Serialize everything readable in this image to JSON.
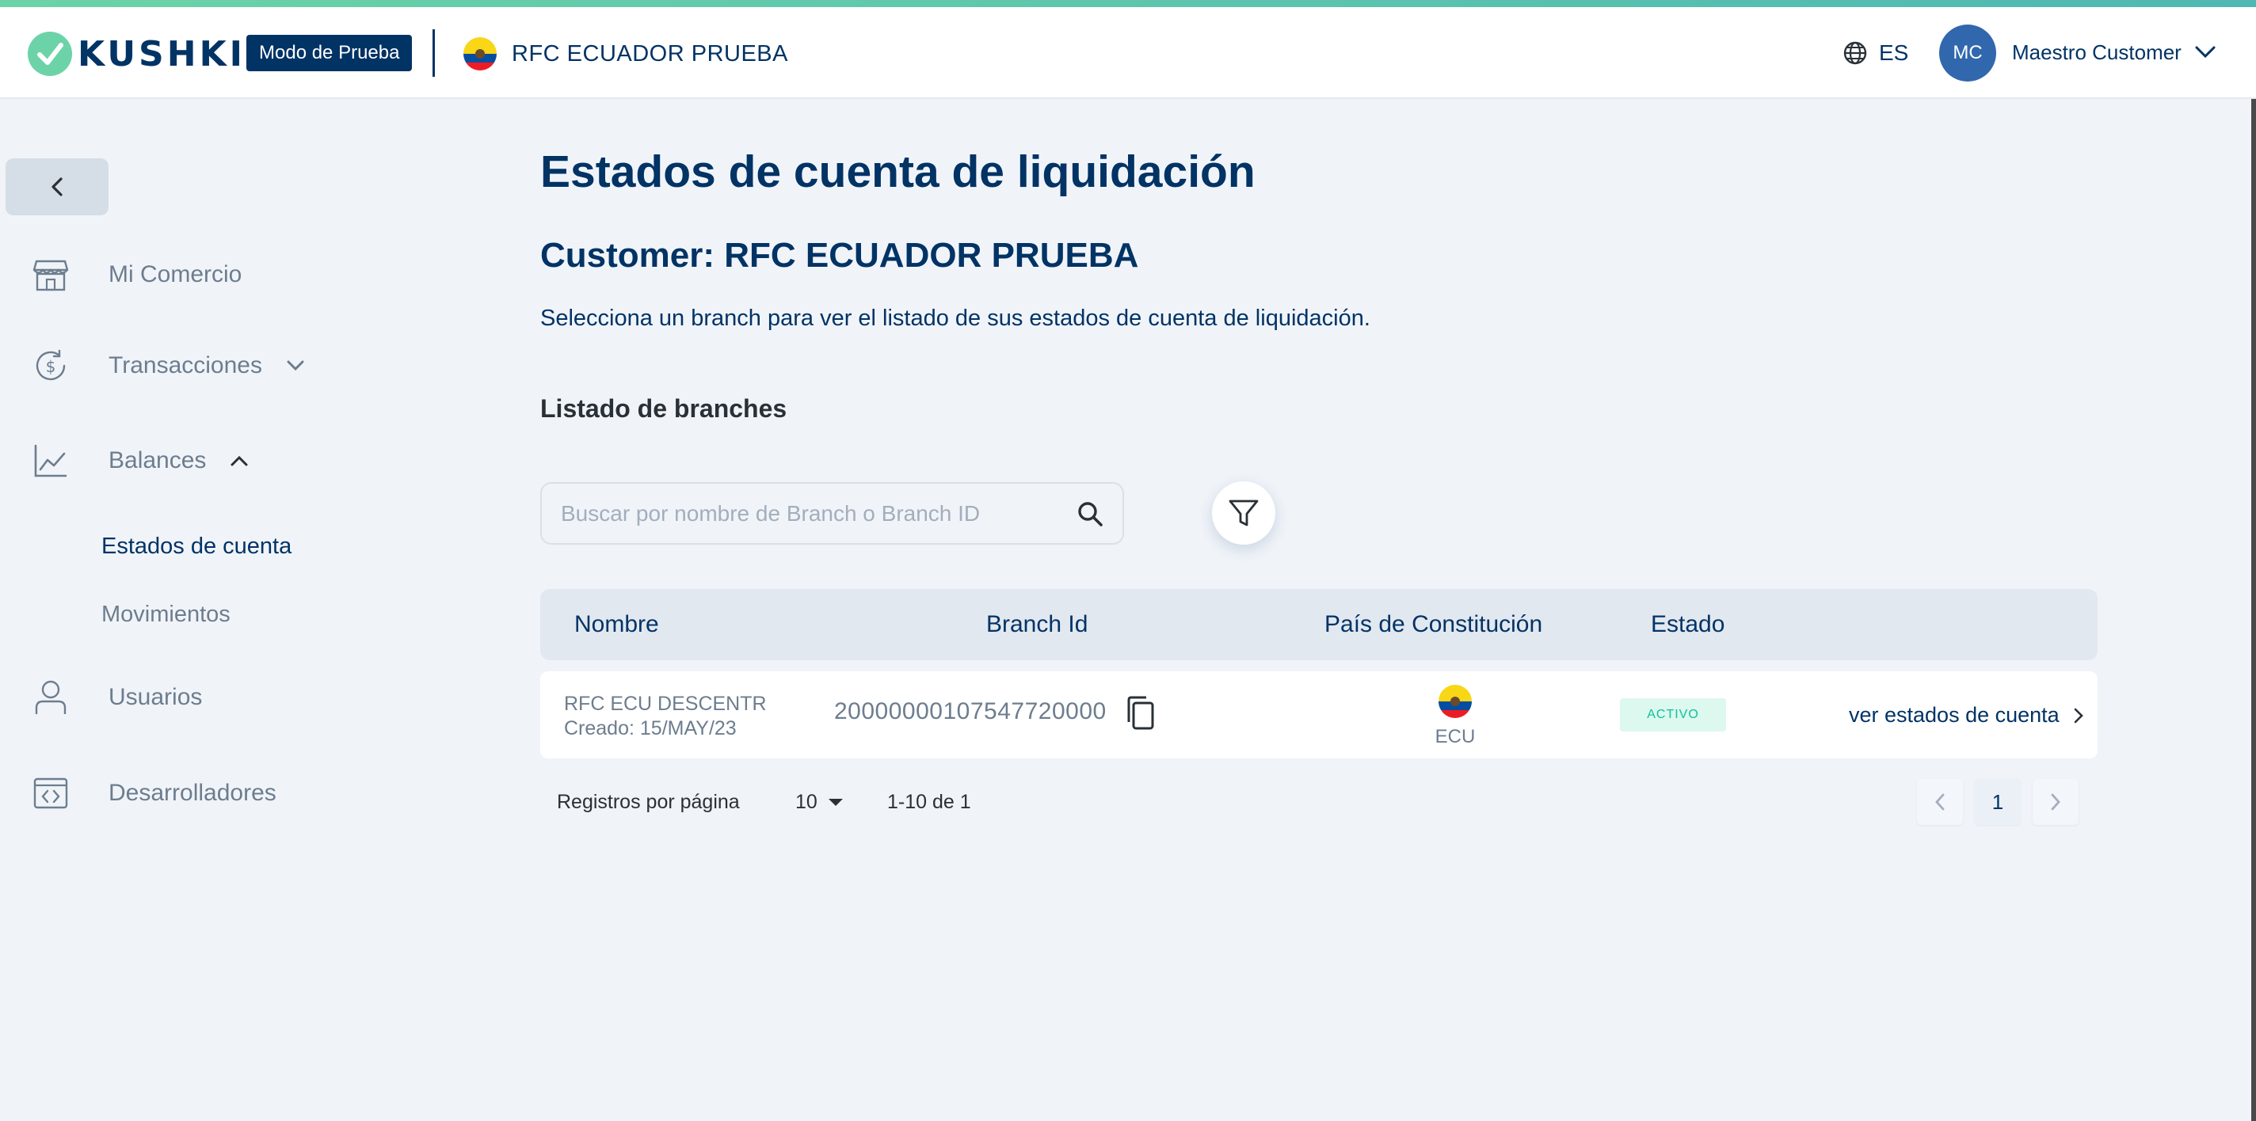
{
  "header": {
    "logo_text": "KUSHKI",
    "mode_badge": "Modo de Prueba",
    "merchant_name": "RFC ECUADOR PRUEBA",
    "language": "ES",
    "user_initials": "MC",
    "user_name": "Maestro Customer"
  },
  "sidebar": {
    "items": [
      {
        "label": "Mi Comercio",
        "icon": "store-icon"
      },
      {
        "label": "Transacciones",
        "icon": "dollar-cycle-icon"
      },
      {
        "label": "Balances",
        "icon": "chart-line-icon"
      },
      {
        "label": "Usuarios",
        "icon": "user-icon"
      },
      {
        "label": "Desarrolladores",
        "icon": "code-window-icon"
      }
    ],
    "balances_sub": [
      "Estados de cuenta",
      "Movimientos"
    ]
  },
  "main": {
    "page_title": "Estados de cuenta de liquidación",
    "customer_title": "Customer: RFC ECUADOR PRUEBA",
    "description": "Selecciona un branch para ver el listado de sus estados de cuenta de liquidación.",
    "section_title": "Listado de branches",
    "search_placeholder": "Buscar por nombre de Branch o Branch ID"
  },
  "table": {
    "headers": [
      "Nombre",
      "Branch Id",
      "País de Constitución",
      "Estado"
    ],
    "rows": [
      {
        "name": "RFC ECU DESCENTR",
        "created": "Creado: 15/MAY/23",
        "branch_id": "20000000107547720000",
        "country": "ECU",
        "status": "ACTIVO",
        "action": "ver estados de cuenta"
      }
    ]
  },
  "pagination": {
    "per_page_label": "Registros por página",
    "per_page": "10",
    "range": "1-10 de 1",
    "current_page": "1"
  },
  "colors": {
    "primary": "#023365",
    "accent_green": "#0dc298",
    "avatar": "#3167ad",
    "background": "#f0f4f9"
  }
}
